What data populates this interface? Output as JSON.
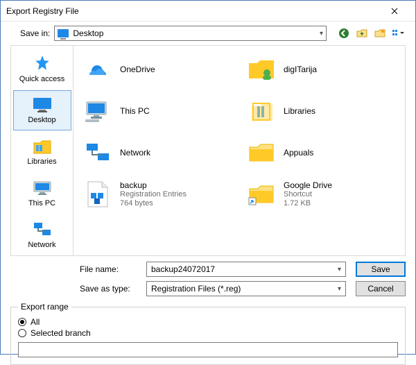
{
  "window": {
    "title": "Export Registry File"
  },
  "topbar": {
    "save_in_label": "Save in:",
    "location": "Desktop",
    "tools": {
      "back": "back",
      "up": "up",
      "newfolder": "newfolder",
      "views": "views"
    }
  },
  "places": [
    {
      "id": "quick-access",
      "label": "Quick access"
    },
    {
      "id": "desktop",
      "label": "Desktop",
      "selected": true
    },
    {
      "id": "libraries",
      "label": "Libraries"
    },
    {
      "id": "this-pc",
      "label": "This PC"
    },
    {
      "id": "network",
      "label": "Network"
    }
  ],
  "items": [
    {
      "id": "onedrive",
      "name": "OneDrive",
      "sub1": "",
      "sub2": ""
    },
    {
      "id": "digitarija",
      "name": "digITarija",
      "sub1": "",
      "sub2": ""
    },
    {
      "id": "this-pc",
      "name": "This PC",
      "sub1": "",
      "sub2": ""
    },
    {
      "id": "libraries",
      "name": "Libraries",
      "sub1": "",
      "sub2": ""
    },
    {
      "id": "network",
      "name": "Network",
      "sub1": "",
      "sub2": ""
    },
    {
      "id": "appuals",
      "name": "Appuals",
      "sub1": "",
      "sub2": ""
    },
    {
      "id": "backup",
      "name": "backup",
      "sub1": "Registration Entries",
      "sub2": "764 bytes"
    },
    {
      "id": "gdrive",
      "name": "Google Drive",
      "sub1": "Shortcut",
      "sub2": "1.72 KB"
    }
  ],
  "form": {
    "file_name_label": "File name:",
    "file_name_value": "backup24072017",
    "save_type_label": "Save as type:",
    "save_type_value": "Registration Files (*.reg)",
    "save_btn": "Save",
    "cancel_btn": "Cancel"
  },
  "export": {
    "legend": "Export range",
    "all_label": "All",
    "selected_label": "Selected branch",
    "branch_value": "",
    "choice": "all"
  }
}
